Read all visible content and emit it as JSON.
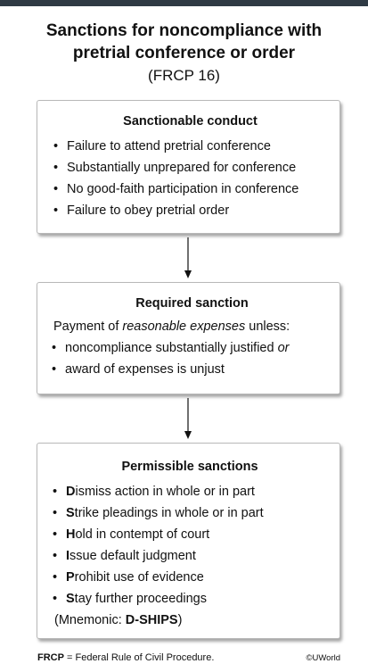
{
  "title_line1": "Sanctions for noncompliance with",
  "title_line2": "pretrial conference or order",
  "subtitle": "(FRCP 16)",
  "box1": {
    "title": "Sanctionable conduct",
    "items": [
      "Failure to attend pretrial conference",
      "Substantially unprepared for conference",
      "No good-faith participation in conference",
      "Failure to obey pretrial order"
    ]
  },
  "box2": {
    "title": "Required sanction",
    "intro_before": "Payment of ",
    "intro_italic": "reasonable expenses",
    "intro_after": " unless:",
    "item1_text": "noncompliance substantially justified ",
    "item1_italic": "or",
    "item2_text": "award of expenses is unjust"
  },
  "box3": {
    "title": "Permissible sanctions",
    "items": [
      {
        "first": "D",
        "rest": "ismiss action in whole or in part"
      },
      {
        "first": "S",
        "rest": "trike pleadings in whole or in part"
      },
      {
        "first": "H",
        "rest": "old in contempt of court"
      },
      {
        "first": "I",
        "rest": "ssue default judgment"
      },
      {
        "first": "P",
        "rest": "rohibit use of evidence"
      },
      {
        "first": "S",
        "rest": "tay further proceedings"
      }
    ],
    "mnemonic_prefix": "(Mnemonic: ",
    "mnemonic_word": "D-SHIPS",
    "mnemonic_suffix": ")"
  },
  "footer": {
    "abbr": "FRCP",
    "definition": " = Federal Rule of Civil Procedure.",
    "copyright": "©UWorld"
  },
  "colors": {
    "top_bar": "#2f3a44",
    "box_border": "#b8b8b8",
    "text": "#111111"
  },
  "bullet_char": "•"
}
